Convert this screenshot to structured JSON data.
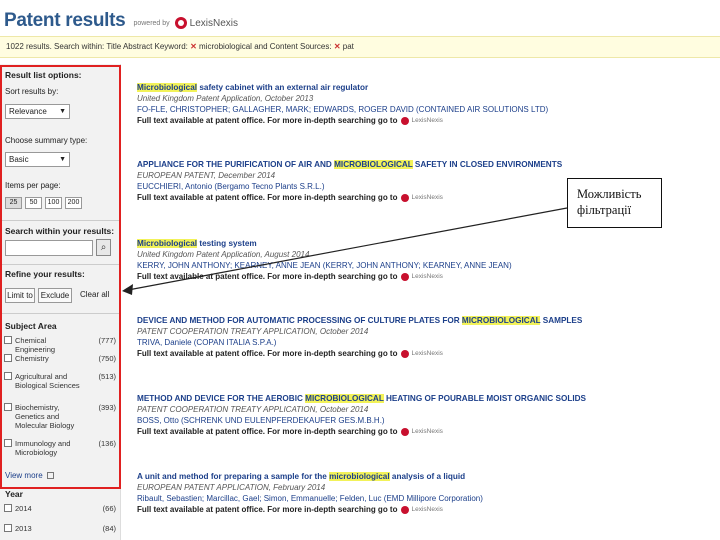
{
  "header": {
    "title": "Patent results",
    "powered_by": "powered by",
    "brand": "LexisNexis"
  },
  "summary": {
    "prefix": "1022 results. Search within: Title Abstract Keyword:",
    "term1": "microbiological",
    "middle": "and Content Sources:",
    "term2": "pat"
  },
  "sidebar": {
    "options_title": "Result list options:",
    "sort_label": "Sort results by:",
    "sort_value": "Relevance",
    "summary_label": "Choose summary type:",
    "summary_value": "Basic",
    "items_label": "Items per page:",
    "pages": [
      "25",
      "50",
      "100",
      "200"
    ],
    "search_title": "Search within your results:",
    "refine_title": "Refine your results:",
    "limit_label": "Limit to",
    "exclude_label": "Exclude",
    "clear_all": "Clear all",
    "subject_title": "Subject Area",
    "subjects": [
      {
        "name": "Chemical Engineering",
        "count": "(777)"
      },
      {
        "name": "Chemistry",
        "count": "(750)"
      },
      {
        "name": "Agricultural and Biological Sciences",
        "count": "(513)"
      },
      {
        "name": "Biochemistry, Genetics and Molecular Biology",
        "count": "(393)"
      },
      {
        "name": "Immunology and Microbiology",
        "count": "(136)"
      }
    ],
    "view_more": "View more",
    "year_title": "Year",
    "years": [
      {
        "name": "2014",
        "count": "(66)"
      },
      {
        "name": "2013",
        "count": "(84)"
      }
    ]
  },
  "results": [
    {
      "title_parts": [
        {
          "text": "Microbiological",
          "hl": true
        },
        {
          "text": " safety cabinet with an external air regulator",
          "hl": false
        }
      ],
      "pub": "United Kingdom Patent Application, October 2013",
      "inventors": "FO-FLE, CHRISTOPHER; GALLAGHER, MARK; EDWARDS, ROGER DAVID (CONTAINED AIR SOLUTIONS LTD)",
      "avail": "Full text available at patent office. For more in-depth searching go to"
    },
    {
      "title_parts": [
        {
          "text": "APPLIANCE FOR THE PURIFICATION OF AIR AND ",
          "hl": false
        },
        {
          "text": "MICROBIOLOGICAL",
          "hl": true
        },
        {
          "text": " SAFETY IN CLOSED ENVIRONMENTS",
          "hl": false
        }
      ],
      "pub": "EUROPEAN PATENT, December 2014",
      "inventors": "EUCCHIERI, Antonio (Bergamo Tecno Plants S.R.L.)",
      "avail": "Full text available at patent office. For more in-depth searching go to"
    },
    {
      "title_parts": [
        {
          "text": "Microbiological",
          "hl": true
        },
        {
          "text": " testing system",
          "hl": false
        }
      ],
      "pub": "United Kingdom Patent Application, August 2014",
      "inventors": "KERRY, JOHN ANTHONY; KEARNEY, ANNE JEAN (KERRY, JOHN ANTHONY; KEARNEY, ANNE JEAN)",
      "avail": "Full text available at patent office. For more in-depth searching go to"
    },
    {
      "title_parts": [
        {
          "text": "DEVICE AND METHOD FOR AUTOMATIC PROCESSING OF CULTURE PLATES FOR ",
          "hl": false
        },
        {
          "text": "MICROBIOLOGICAL",
          "hl": true
        },
        {
          "text": " SAMPLES",
          "hl": false
        }
      ],
      "pub": "PATENT COOPERATION TREATY APPLICATION, October 2014",
      "inventors": "TRIVA, Daniele (COPAN ITALIA S.P.A.)",
      "avail": "Full text available at patent office. For more in-depth searching go to"
    },
    {
      "title_parts": [
        {
          "text": "METHOD AND DEVICE FOR THE AEROBIC ",
          "hl": false
        },
        {
          "text": "MICROBIOLOGICAL",
          "hl": true
        },
        {
          "text": " HEATING OF POURABLE MOIST ORGANIC SOLIDS",
          "hl": false
        }
      ],
      "pub": "PATENT COOPERATION TREATY APPLICATION, October 2014",
      "inventors": "BOSS, Otto (SCHRENK UND EULENPFERDEKAUFER GES.M.B.H.)",
      "avail": "Full text available at patent office. For more in-depth searching go to"
    },
    {
      "title_parts": [
        {
          "text": "A unit and method for preparing a sample for the ",
          "hl": false
        },
        {
          "text": "microbiological",
          "hl": true
        },
        {
          "text": " analysis of a liquid",
          "hl": false
        }
      ],
      "pub": "EUROPEAN PATENT APPLICATION, February 2014",
      "inventors": "Ribault, Sebastien; Marcillac, Gael; Simon, Emmanuelle; Felden, Luc (EMD Millipore Corporation)",
      "avail": "Full text available at patent office. For more in-depth searching go to"
    }
  ],
  "lexisnexis_small": "LexisNexis",
  "callout": {
    "line1": "Можливість",
    "line2": "фільтрації"
  },
  "colors": {
    "title_blue": "#2e5a8c",
    "link_blue": "#1c3f8a",
    "highlight": "#f2f259",
    "annotation_red": "#e02020",
    "brand_red": "#c8102e"
  }
}
